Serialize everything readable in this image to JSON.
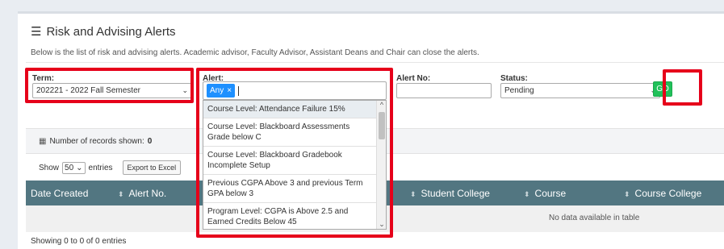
{
  "page": {
    "title": "Risk and Advising Alerts",
    "description": "Below is the list of risk and advising alerts. Academic advisor, Faculty Advisor, Assistant Deans and Chair can close the alerts."
  },
  "filters": {
    "term_label": "Term:",
    "term_value": "202221 - 2022 Fall Semester",
    "alert_label": "Alert:",
    "alert_chip": "Any",
    "alert_chip_remove": "×",
    "alert_no_label": "Alert No:",
    "alert_no_value": "",
    "status_label": "Status:",
    "status_value": "Pending",
    "go_label": "GO"
  },
  "alert_options": [
    "Course Level: Attendance Failure 15%",
    "Course Level: Blackboard Assessments Grade below C",
    "Course Level: Blackboard Gradebook Incomplete Setup",
    "Previous CGPA Above 3 and previous Term GPA below 3",
    "Program Level: CGPA is Above 2.5 and Earned Credits Below 45"
  ],
  "records": {
    "label": "Number of records shown:",
    "count": "0"
  },
  "length": {
    "show": "Show",
    "value": "50",
    "entries": "entries",
    "export": "Export to Excel"
  },
  "table": {
    "columns": [
      "Date Created",
      "Alert No.",
      "Student College",
      "Course",
      "Course College"
    ],
    "empty": "No data available in table",
    "info": "Showing 0 to 0 of 0 entries"
  },
  "colors": {
    "highlight_box": "#e6001a",
    "table_header": "#527681",
    "go_button": "#21c15a",
    "chip": "#1e90ff"
  }
}
